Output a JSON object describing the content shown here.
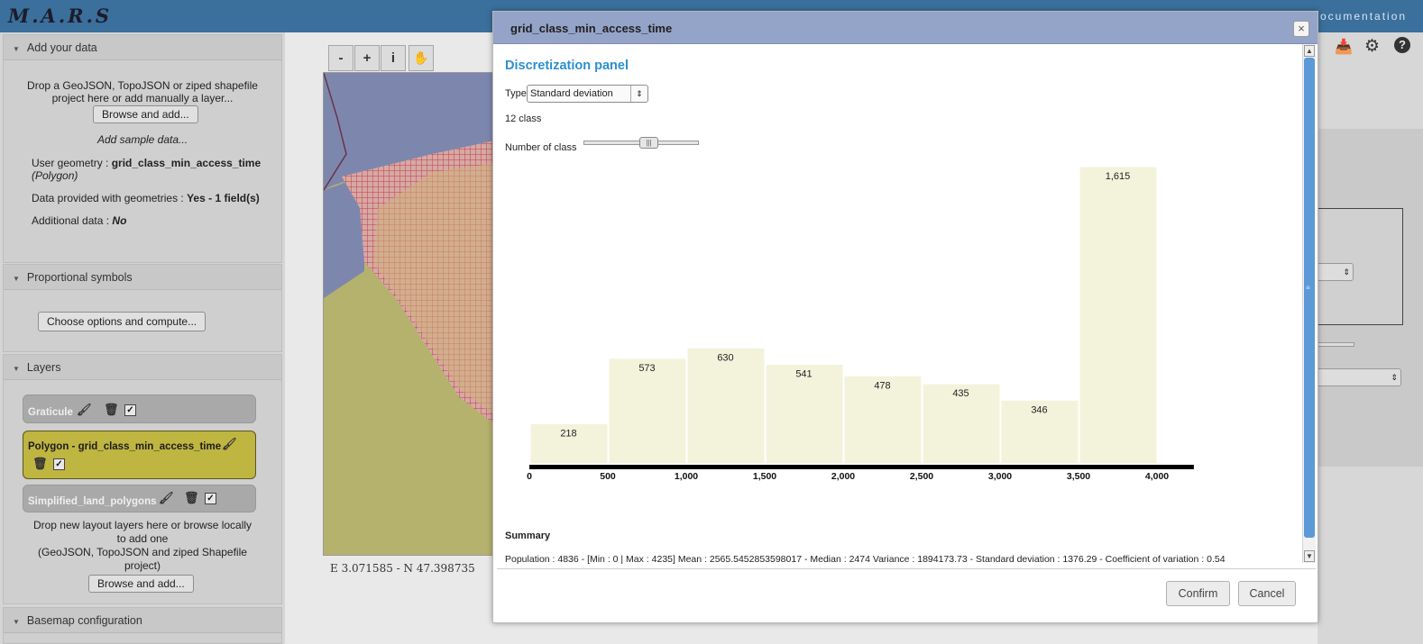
{
  "app": {
    "title": "M.A.R.S",
    "doc_link": "ocumentation"
  },
  "left": {
    "add_data": {
      "header": "Add your data",
      "drop_text_1": "Drop a GeoJSON, TopoJSON or ziped shapefile",
      "drop_text_2": "project here or add manually a layer...",
      "browse_button": "Browse and add...",
      "sample_link": "Add sample data...",
      "geom_label": "User geometry : ",
      "geom_value": "grid_class_min_access_time",
      "geom_type": "(Polygon)",
      "provided_label": "Data provided with geometries : ",
      "provided_value": "Yes - 1 field(s)",
      "additional_label": "Additional data : ",
      "additional_value": "No"
    },
    "prop_symbols": {
      "header": "Proportional symbols",
      "button": "Choose options and compute..."
    },
    "layers": {
      "header": "Layers",
      "items": [
        {
          "name": "Graticule"
        },
        {
          "name": "Polygon - grid_class_min_access_time"
        },
        {
          "name": "Simplified_land_polygons"
        }
      ],
      "drop_text_1": "Drop new layout layers here or browse locally",
      "drop_text_2": "to add one",
      "drop_text_3": "(GeoJSON, TopoJSON and ziped Shapefile",
      "drop_text_4": "project)",
      "browse_button": "Browse and add..."
    },
    "basemap": {
      "header": "Basemap configuration"
    }
  },
  "map": {
    "tools": [
      "-",
      "+",
      "i",
      "✋"
    ],
    "coords": "E 3.071585 - N 47.398735"
  },
  "dialog": {
    "title": "grid_class_min_access_time",
    "close": "×",
    "panel_title": "Discretization panel",
    "type_label": "Type",
    "type_value": "Standard deviation",
    "class_count": "12 class",
    "nclass_label": "Number of class",
    "slider_fraction": 0.58,
    "summary_title": "Summary",
    "summary_text": "Population : 4836 - [Min : 0 | Max : 4235] Mean : 2565.5452853598017 - Median : 2474 Variance : 1894173.73 - Standard deviation : 1376.29 - Coefficient of variation : 0.54",
    "confirm": "Confirm",
    "cancel": "Cancel"
  },
  "colors": {
    "topbar": "#3b6f9c",
    "dialog_header": "#93a4c8",
    "panel_title": "#2c8fcf",
    "bar_fill": "#f3f3dc",
    "active_layer": "#bfb541"
  },
  "chart_data": {
    "type": "bar",
    "categories": [
      "0–500",
      "500–1,000",
      "1,000–1,500",
      "1,500–2,000",
      "2,000–2,500",
      "2,500–3,000",
      "3,000–3,500",
      "3,500–4,000"
    ],
    "values": [
      218,
      573,
      630,
      541,
      478,
      435,
      346,
      1615
    ],
    "value_labels": [
      "218",
      "573",
      "630",
      "541",
      "478",
      "435",
      "346",
      "1,615"
    ],
    "x_ticks": [
      0,
      500,
      1000,
      1500,
      2000,
      2500,
      3000,
      3500,
      4000
    ],
    "x_tick_labels": [
      "0",
      "500",
      "1,000",
      "1,500",
      "2,000",
      "2,500",
      "3,000",
      "3,500",
      "4,000"
    ],
    "xlim": [
      0,
      4235
    ],
    "ylim": [
      0,
      1700
    ],
    "title": "",
    "xlabel": "",
    "ylabel": ""
  }
}
